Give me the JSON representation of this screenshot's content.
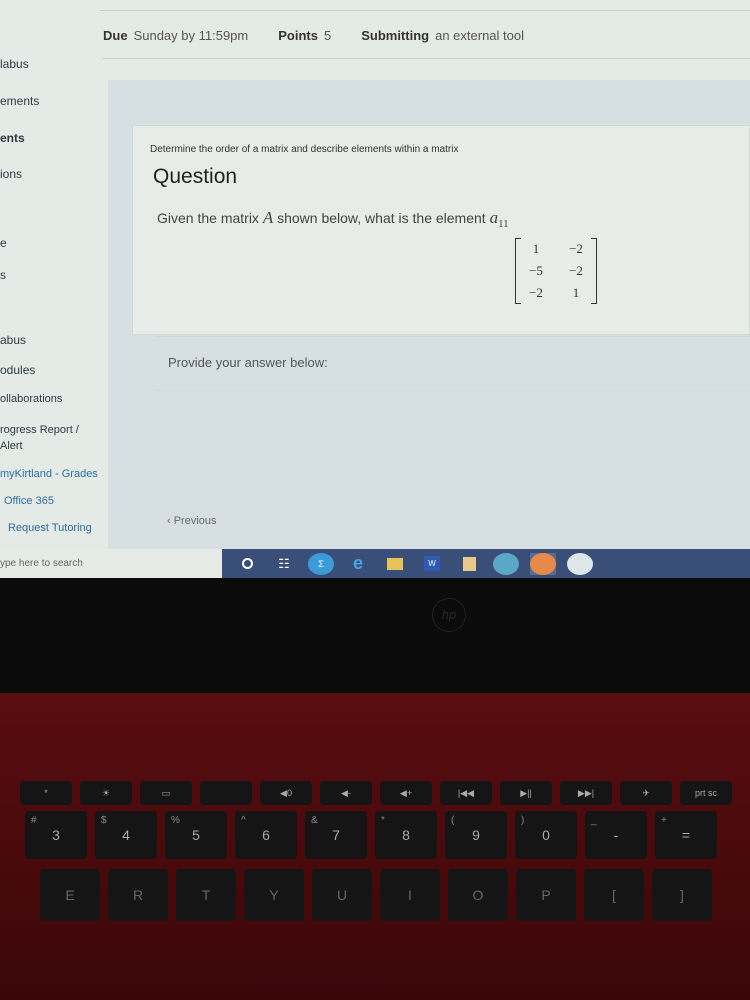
{
  "assignment_meta": {
    "due_label": "Due",
    "due_value": "Sunday by 11:59pm",
    "points_label": "Points",
    "points_value": "5",
    "submitting_label": "Submitting",
    "submitting_value": "an external tool"
  },
  "sidebar": {
    "items": [
      "labus",
      "ements",
      "ents",
      "ions",
      "e",
      "s",
      "abus",
      "odules",
      "ollaborations",
      "rogress Report / Alert",
      "myKirtland - Grades",
      "Office 365",
      "Request Tutoring"
    ]
  },
  "question": {
    "subtitle": "Determine the order of a matrix and describe elements within a matrix",
    "title": "Question",
    "text_before": "Given the matrix",
    "matrix_name": "A",
    "text_after": "shown below, what is the element",
    "element": "a",
    "element_sub": "11",
    "matrix": [
      [
        "1",
        "−2"
      ],
      [
        "−5",
        "−2"
      ],
      [
        "−2",
        "1"
      ]
    ]
  },
  "answer": {
    "prompt": "Provide your answer below:"
  },
  "nav": {
    "previous": "‹ Previous"
  },
  "taskbar": {
    "search_placeholder": "ype here to search",
    "icons": [
      "cortana-icon",
      "task-view-icon",
      "sigma-app-icon",
      "internet-explorer-icon",
      "file-explorer-icon",
      "word-icon",
      "media-icon",
      "chrome-icon",
      "firefox-icon",
      "app-icon"
    ]
  },
  "laptop": {
    "logo": "hp"
  },
  "keyboard": {
    "fn_row": [
      "*",
      "☀",
      "▭",
      "",
      "◀0",
      "◀-",
      "◀+",
      "|◀◀",
      "▶||",
      "▶▶|",
      "✈",
      "prt sc"
    ],
    "num_row": [
      {
        "k": "3",
        "s": "#"
      },
      {
        "k": "4",
        "s": "$"
      },
      {
        "k": "5",
        "s": "%"
      },
      {
        "k": "6",
        "s": "^"
      },
      {
        "k": "7",
        "s": "&"
      },
      {
        "k": "8",
        "s": "*"
      },
      {
        "k": "9",
        "s": "("
      },
      {
        "k": "0",
        "s": ")"
      },
      {
        "k": "-",
        "s": "_"
      },
      {
        "k": "=",
        "s": "+"
      }
    ],
    "letter_row": [
      "E",
      "R",
      "T",
      "Y",
      "U",
      "I",
      "O",
      "P",
      "[",
      "]"
    ]
  }
}
